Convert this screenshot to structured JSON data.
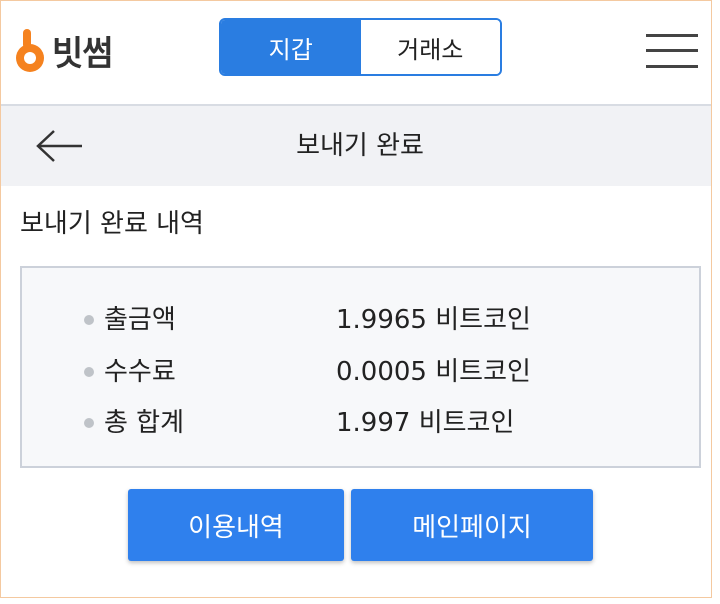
{
  "header": {
    "logo_text": "빗썸",
    "tabs": [
      {
        "label": "지갑",
        "active": true
      },
      {
        "label": "거래소",
        "active": false
      }
    ],
    "menu_icon": "hamburger-menu-icon"
  },
  "title_bar": {
    "back_icon": "arrow-left-icon",
    "title": "보내기 완료"
  },
  "section_title": "보내기 완료 내역",
  "details": [
    {
      "label": "출금액",
      "value": "1.9965 비트코인"
    },
    {
      "label": "수수료",
      "value": "0.0005 비트코인"
    },
    {
      "label": "총 합계",
      "value": "1.997 비트코인"
    }
  ],
  "buttons": {
    "history": "이용내역",
    "main_page": "메인페이지"
  },
  "colors": {
    "accent": "#2a7de1",
    "button": "#2f80ed",
    "logo_orange": "#f5821f"
  }
}
